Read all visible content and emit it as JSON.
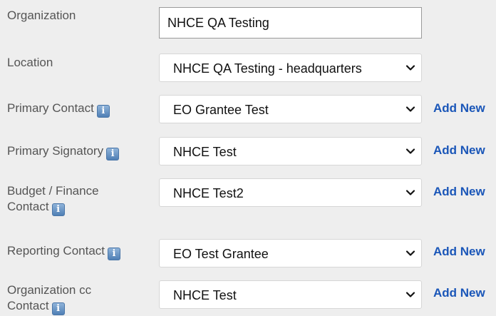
{
  "organization": {
    "label": "Organization",
    "value": "NHCE QA Testing"
  },
  "location": {
    "label": "Location",
    "selected": "NHCE QA Testing - headquarters"
  },
  "primary_contact": {
    "label": "Primary Contact",
    "selected": "EO Grantee Test",
    "add_new": "Add New"
  },
  "primary_signatory": {
    "label": "Primary Signatory",
    "selected": "NHCE Test",
    "add_new": "Add New"
  },
  "budget_finance_contact": {
    "label_line1": "Budget / Finance",
    "label_line2": "Contact",
    "selected": "NHCE Test2",
    "add_new": "Add New"
  },
  "reporting_contact": {
    "label": "Reporting Contact",
    "selected": "EO Test Grantee",
    "add_new": "Add New"
  },
  "organization_cc_contact": {
    "label_line1": "Organization cc",
    "label_line2": "Contact",
    "selected": "NHCE Test",
    "add_new": "Add New"
  },
  "icons": {
    "info": "info-icon",
    "dropdown": "chevron-down-icon"
  },
  "colors": {
    "background": "#eeeeee",
    "link": "#1a56b8",
    "label": "#555555"
  }
}
